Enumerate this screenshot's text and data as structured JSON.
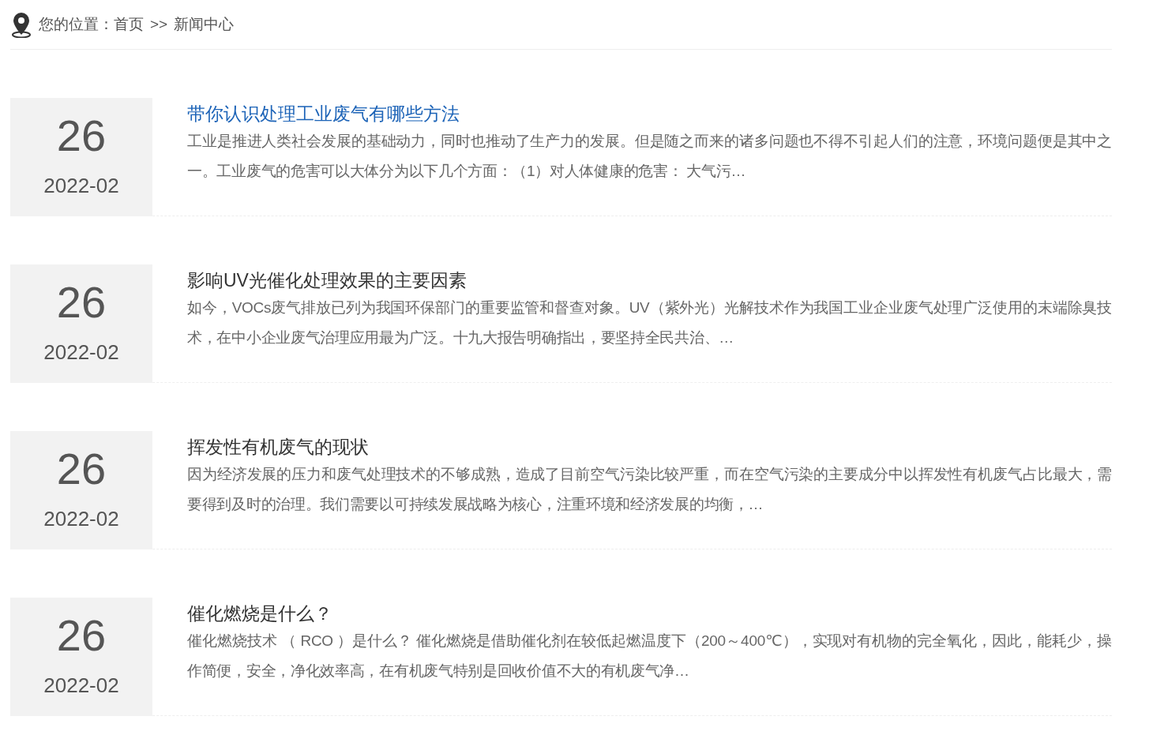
{
  "breadcrumb": {
    "label": "您的位置：",
    "items": [
      {
        "text": "首页"
      },
      {
        "text": ">>"
      },
      {
        "text": "新闻中心"
      }
    ]
  },
  "news": [
    {
      "day": "26",
      "month": "2022-02",
      "title": "带你认识处理工业废气有哪些方法",
      "selected": true,
      "excerpt": "工业是推进人类社会发展的基础动力，同时也推动了生产力的发展。但是随之而来的诸多问题也不得不引起人们的注意，环境问题便是其中之一。工业废气的危害可以大体分为以下几个方面：（1）对人体健康的危害： 大气污…"
    },
    {
      "day": "26",
      "month": "2022-02",
      "title": "影响UV光催化处理效果的主要因素",
      "selected": false,
      "excerpt": "如今，VOCs废气排放已列为我国环保部门的重要监管和督查对象。UV（紫外光）光解技术作为我国工业企业废气处理广泛使用的末端除臭技术，在中小企业废气治理应用最为广泛。十九大报告明确指出，要坚持全民共治、…"
    },
    {
      "day": "26",
      "month": "2022-02",
      "title": "挥发性有机废气的现状",
      "selected": false,
      "excerpt": "因为经济发展的压力和废气处理技术的不够成熟，造成了目前空气污染比较严重，而在空气污染的主要成分中以挥发性有机废气占比最大，需要得到及时的治理。我们需要以可持续发展战略为核心，注重环境和经济发展的均衡，…"
    },
    {
      "day": "26",
      "month": "2022-02",
      "title": "催化燃烧是什么？",
      "selected": false,
      "excerpt": "催化燃烧技术 （ RCO ）是什么？ 催化燃烧是借助催化剂在较低起燃温度下（200～400℃），实现对有机物的完全氧化，因此，能耗少，操作简便，安全，净化效率高，在有机废气特别是回收价值不大的有机废气净…"
    }
  ]
}
